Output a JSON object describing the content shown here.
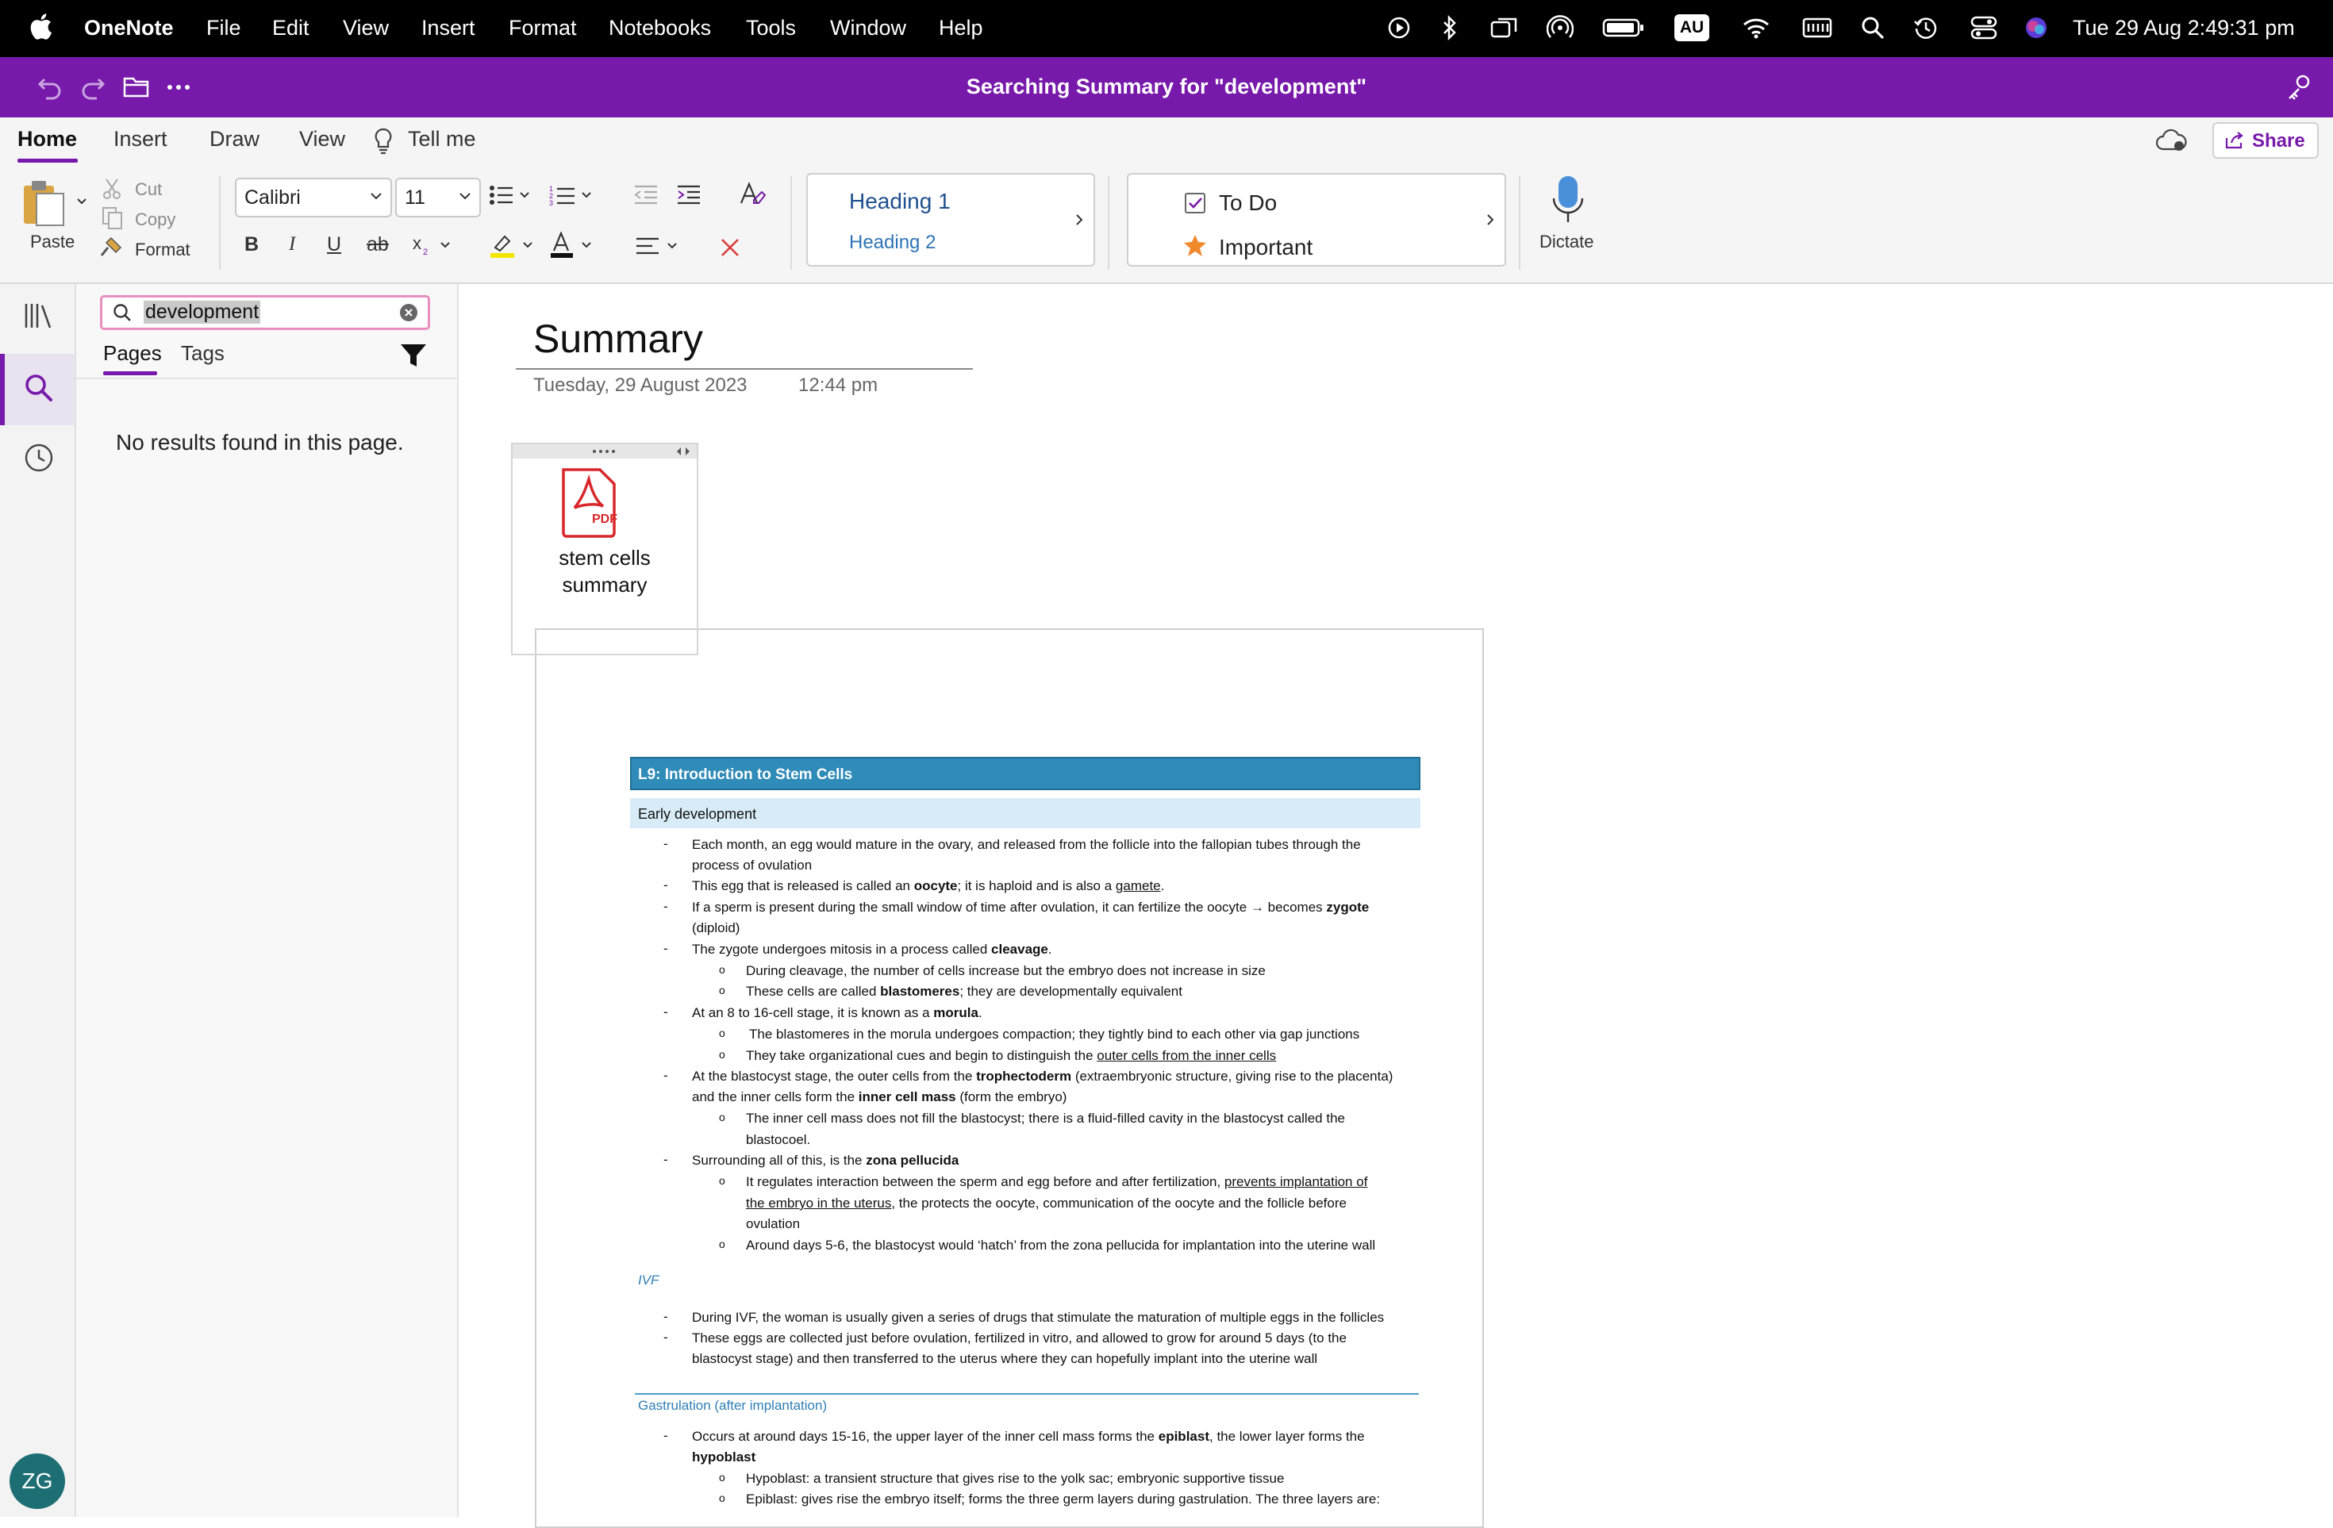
{
  "menubar": {
    "app": "OneNote",
    "items": [
      "File",
      "Edit",
      "View",
      "Insert",
      "Format",
      "Notebooks",
      "Tools",
      "Window",
      "Help"
    ],
    "input_source": "AU",
    "clock": "Tue 29 Aug  2:49:31 pm"
  },
  "titlebar": {
    "title": "Searching Summary for \"development\""
  },
  "ribbon": {
    "tabs": [
      "Home",
      "Insert",
      "Draw",
      "View"
    ],
    "tell_me": "Tell me",
    "share": "Share",
    "paste": "Paste",
    "cut": "Cut",
    "copy": "Copy",
    "format": "Format",
    "font": "Calibri",
    "size": "11",
    "heading1": "Heading 1",
    "heading2": "Heading 2",
    "todo": "To Do",
    "important": "Important",
    "dictate": "Dictate"
  },
  "rail": {
    "initials": "ZG"
  },
  "search": {
    "query": "development",
    "tabs": [
      "Pages",
      "Tags"
    ],
    "no_results": "No results found in this page."
  },
  "page": {
    "title": "Summary",
    "date": "Tuesday, 29 August 2023",
    "time": "12:44 pm",
    "attachment": {
      "line1": "stem cells",
      "line2": "summary",
      "badge": "PDF"
    }
  },
  "doc": {
    "title": "L9: Introduction to Stem Cells",
    "section1": "Early development",
    "lines": [
      "Each month, an egg would mature in the ovary, and released from the follicle into the fallopian tubes through the",
      "process of ovulation",
      "This egg that is released is called an ",
      "oocyte",
      "; it is haploid and is also a ",
      "gamete",
      ".",
      "If a sperm is present during the small window of time after ovulation, it can fertilize the oocyte → becomes ",
      "zygote",
      "(diploid)",
      "The zygote undergoes mitosis in a process called ",
      "cleavage",
      "During cleavage, the number of cells increase but the embryo does not increase in size",
      "These cells are called ",
      "blastomeres",
      "; they are developmentally equivalent",
      "At an 8 to 16-cell stage, it is known as a ",
      "morula",
      "The blastomeres in the morula undergoes compaction; they tightly bind to each other via gap junctions",
      "They take organizational cues and begin to distinguish the ",
      "outer cells from the inner cells",
      "At the blastocyst stage, the outer cells from the ",
      "trophectoderm",
      " (extraembryonic structure, giving rise to the placenta)",
      "and the inner cells form the ",
      "inner cell mass",
      " (form the embryo)",
      "The inner cell mass does not fill the blastocyst; there is a fluid-filled cavity in the blastocyst called the",
      "blastocoel.",
      "Surrounding all of this, is the ",
      "zona pellucida",
      "It regulates interaction between the sperm and egg before and after fertilization, ",
      "prevents implantation of",
      "the embryo in the uterus",
      ", the protects the oocyte, communication of the oocyte and the follicle before",
      "ovulation",
      "Around days 5-6, the blastocyst would ‘hatch’ from the zona pellucida for implantation into the uterine wall"
    ],
    "ivf_heading": "IVF",
    "ivf_lines": [
      "During IVF, the woman is usually given a series of drugs that stimulate the maturation of multiple eggs in the follicles",
      "These eggs are collected just before ovulation, fertilized in vitro, and allowed to grow for around 5 days (to the",
      "blastocyst stage) and then transferred to the uterus where they can hopefully implant into the uterine wall"
    ],
    "gas_heading": "Gastrulation (after implantation)",
    "gas_lines": [
      "Occurs at around days 15-16, the upper layer of the inner cell mass forms the ",
      "epiblast",
      ", the lower layer forms the",
      "hypoblast",
      "Hypoblast: a transient structure that gives rise to the yolk sac; embryonic supportive tissue",
      "Epiblast: gives rise the embryo itself; forms the three germ layers during gastrulation. The three layers are:"
    ]
  },
  "colors": {
    "brand": "#7719aa",
    "search_highlight": "#e98fc0",
    "doc_title": "#2f8bb8"
  }
}
